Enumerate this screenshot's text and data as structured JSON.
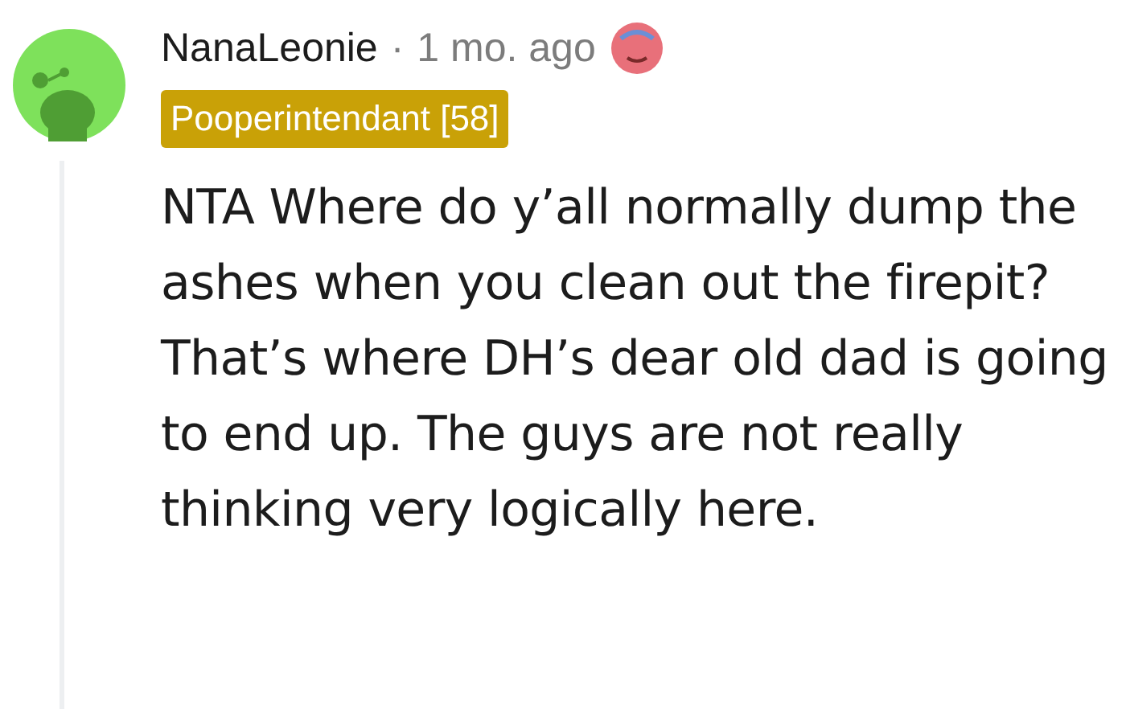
{
  "comment": {
    "author": "NanaLeonie",
    "separator": "·",
    "time": "1 mo. ago",
    "flair": {
      "text": "Pooperintendant [58]",
      "color": "#c9a107"
    },
    "body": "NTA Where do y’all normally dump the ashes when you clean out the firepit? That’s where DH’s dear old dad is going to end up. The guys are not really thinking very logically here."
  }
}
